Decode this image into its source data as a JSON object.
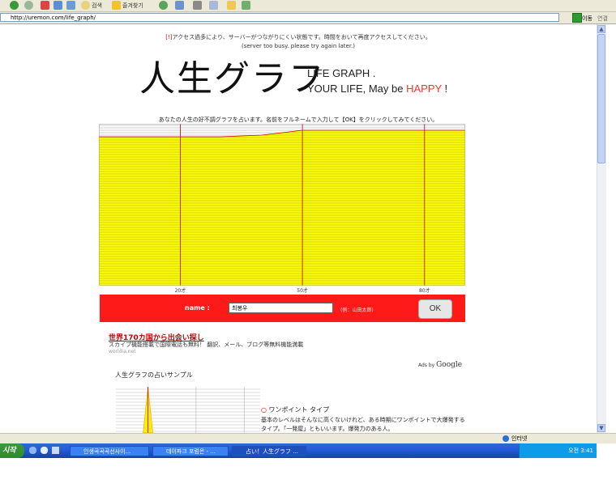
{
  "browser": {
    "toolbar_labels": [
      "검색",
      "즐겨찾기"
    ],
    "address": "http://uremon.com/life_graph/",
    "go_label": "이동",
    "links_label": "연결",
    "status_zone": "인터넷"
  },
  "page": {
    "notice_prefix": "[!]",
    "notice_text": "アクセス過多により、サーバーがつながりにくい状態です。時間をおいて再度アクセスしてください。",
    "notice_en": "(server too busy. please try again later.)",
    "title_jp": "人生グラフ",
    "title_en_line1": "LIFE GRAPH .",
    "title_en_line2_prefix": "YOUR LIFE, May be ",
    "title_en_happy": "HAPPY",
    "title_en_suffix": " !",
    "instruction": "あなたの人生の好不調グラフを占います。名前をフルネームで入力して【OK】をクリックしてみてください。",
    "form": {
      "name_label": "name :",
      "name_value": "최봉우",
      "name_hint": "(例：山田太郎)",
      "ok_label": "OK"
    },
    "ad": {
      "title": "世界170カ国から出会い探し",
      "desc": "スカイプ機能搭載で国際電話も無料！ 翻訳、メール、ブログ等無料機能満載",
      "url": "worldia.net",
      "ads_by": "Ads by ",
      "google": "Google"
    },
    "sample": {
      "title": "人生グラフの占いサンプル",
      "type_mark": "○",
      "type_name": "ワンポイント タイプ",
      "desc1": "基本のレベルはそんなに高くないけれど、ある時期にワンポイントで大爆発する",
      "desc2": "タイプ。「一発屋」ともいいます。爆発力のある人。"
    }
  },
  "chart_data": {
    "type": "area",
    "x_ticks": [
      "20才",
      "50才",
      "80才"
    ],
    "x": [
      0,
      10,
      20,
      30,
      40,
      50,
      60,
      70,
      80,
      90
    ],
    "values": [
      92,
      92,
      92,
      92,
      93,
      96,
      96,
      96,
      96,
      96
    ],
    "ylim": [
      0,
      100
    ],
    "colors": {
      "fill": "#ffff00",
      "line": "#000000",
      "curve": "#cc0000"
    }
  },
  "sample_chart_data": {
    "type": "area",
    "x": [
      0,
      10,
      20,
      30,
      40,
      50,
      60,
      70,
      80,
      90
    ],
    "values": [
      0,
      0,
      0,
      0,
      0,
      0,
      0,
      0,
      0,
      0
    ],
    "spike_at": 20,
    "spike_value": 100,
    "ylim": [
      0,
      100
    ]
  },
  "taskbar": {
    "start_label": "시작",
    "tasks": [
      "인생곡곡곡선사이...",
      "데이파크 포럼은 - ...",
      "占い！人生グラフ ..."
    ],
    "clock": "오전 3:41"
  }
}
